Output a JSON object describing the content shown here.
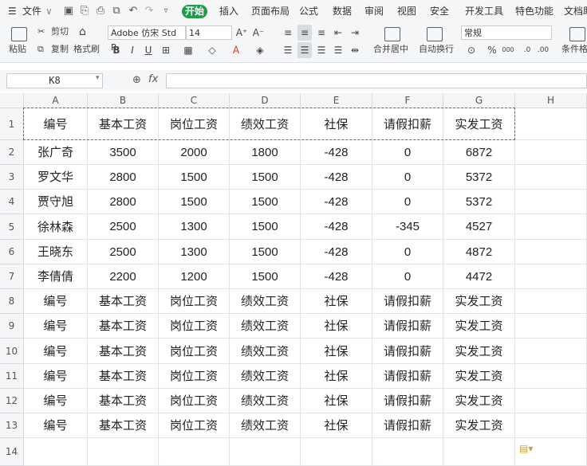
{
  "menu": {
    "file": "文件",
    "tabs": [
      "开始",
      "插入",
      "页面布局",
      "公式",
      "数据",
      "审阅",
      "视图",
      "安全",
      "开发工具",
      "特色功能",
      "文档助"
    ]
  },
  "ribbon": {
    "paste": "粘贴",
    "cut": "剪切",
    "copy": "复制",
    "format_painter": "格式刷",
    "font_name": "Adobe 仿宋 Std R",
    "font_size": "14",
    "bold": "B",
    "italic": "I",
    "underline": "U",
    "merge_center": "合并居中",
    "wrap_text": "自动换行",
    "number_format": "常规",
    "percent": "%",
    "thousands": "000",
    "cond_format": "条件格"
  },
  "formula_bar": {
    "name_box": "K8",
    "fx": "fx"
  },
  "columns": [
    "A",
    "B",
    "C",
    "D",
    "E",
    "F",
    "G",
    "H"
  ],
  "rows": [
    "1",
    "2",
    "3",
    "4",
    "5",
    "6",
    "7",
    "8",
    "9",
    "10",
    "11",
    "12",
    "13",
    "14"
  ],
  "cells": [
    [
      "编号",
      "基本工资",
      "岗位工资",
      "绩效工资",
      "社保",
      "请假扣薪",
      "实发工资"
    ],
    [
      "张广奇",
      "3500",
      "2000",
      "1800",
      "-428",
      "0",
      "6872"
    ],
    [
      "罗文华",
      "2800",
      "1500",
      "1500",
      "-428",
      "0",
      "5372"
    ],
    [
      "贾守旭",
      "2800",
      "1500",
      "1500",
      "-428",
      "0",
      "5372"
    ],
    [
      "徐林森",
      "2500",
      "1300",
      "1500",
      "-428",
      "-345",
      "4527"
    ],
    [
      "王晓东",
      "2500",
      "1300",
      "1500",
      "-428",
      "0",
      "4872"
    ],
    [
      "李倩倩",
      "2200",
      "1200",
      "1500",
      "-428",
      "0",
      "4472"
    ],
    [
      "编号",
      "基本工资",
      "岗位工资",
      "绩效工资",
      "社保",
      "请假扣薪",
      "实发工资"
    ],
    [
      "编号",
      "基本工资",
      "岗位工资",
      "绩效工资",
      "社保",
      "请假扣薪",
      "实发工资"
    ],
    [
      "编号",
      "基本工资",
      "岗位工资",
      "绩效工资",
      "社保",
      "请假扣薪",
      "实发工资"
    ],
    [
      "编号",
      "基本工资",
      "岗位工资",
      "绩效工资",
      "社保",
      "请假扣薪",
      "实发工资"
    ],
    [
      "编号",
      "基本工资",
      "岗位工资",
      "绩效工资",
      "社保",
      "请假扣薪",
      "实发工资"
    ],
    [
      "编号",
      "基本工资",
      "岗位工资",
      "绩效工资",
      "社保",
      "请假扣薪",
      "实发工资"
    ]
  ],
  "colors": {
    "accent": "#1e9b4d",
    "selection": "#1e9b4d"
  }
}
